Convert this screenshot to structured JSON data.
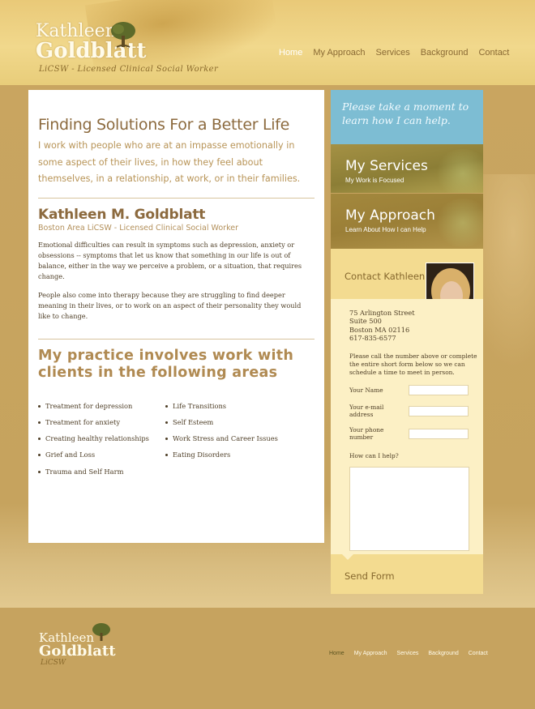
{
  "header": {
    "logo_line1": "Kathleen",
    "logo_line2": "Goldblatt",
    "tagline": "LiCSW - Licensed Clinical Social Worker",
    "nav": [
      "Home",
      "My Approach",
      "Services",
      "Background",
      "Contact"
    ],
    "active_nav": "Home"
  },
  "main": {
    "title": "Finding Solutions For a Better Life",
    "intro": "I work with people who are at an impasse emotionally in some aspect of their lives, in how they feel about themselves, in a relationship, at work, or in their families.",
    "name": "Kathleen M. Goldblatt",
    "subtitle": "Boston Area LiCSW - Licensed Clinical Social Worker",
    "para1": "Emotional difficulties can result in symptoms such as depression, anxiety or obsessions -- symptoms that let us know that something in our life is out of balance, either in the way we perceive a problem, or a situation, that requires change.",
    "para2": "People also come into therapy because they are struggling to find deeper meaning in their lives, or to work on an aspect of their personality they would like to change.",
    "practice_heading_line1": "My practice involves work with",
    "practice_heading_line2": "clients in the following areas",
    "areas_col1": [
      "Treatment for depression",
      "Treatment for anxiety",
      "Creating healthy relationships",
      "Grief and Loss",
      "Trauma and Self Harm"
    ],
    "areas_col2": [
      "Life Transitions",
      "Self Esteem",
      "Work Stress and Career Issues",
      "Eating Disorders"
    ]
  },
  "sidebar": {
    "callout": "Please take a moment to learn how I can help.",
    "services": {
      "title": "My Services",
      "subtitle": "My Work is Focused"
    },
    "approach": {
      "title": "My Approach",
      "subtitle": "Learn About How I can Help"
    },
    "contact_heading": "Contact Kathleen",
    "address": [
      "75 Arlington Street",
      "Suite 500",
      "Boston MA 02116",
      "617-835-6577"
    ],
    "note": "Please call the number above or complete the entire short form below so we can schedule a time to meet in person.",
    "form": {
      "name_label": "Your Name",
      "email_label": "Your e-mail address",
      "phone_label": "Your phone number",
      "help_label": "How can I help?",
      "submit_label": "Send Form"
    }
  },
  "footer": {
    "logo_line1": "Kathleen",
    "logo_line2": "Goldblatt",
    "logo_line3": "LiCSW",
    "nav": [
      "Home",
      "My Approach",
      "Services",
      "Background",
      "Contact"
    ]
  },
  "colors": {
    "brand_gold": "#c9a560",
    "heading_brown": "#8c6a3e",
    "callout_blue": "#7dbdd3",
    "form_cream": "#fcf0c5"
  },
  "icons": [
    "tree-logo-icon",
    "footer-tree-logo-icon",
    "bullet-icon"
  ]
}
